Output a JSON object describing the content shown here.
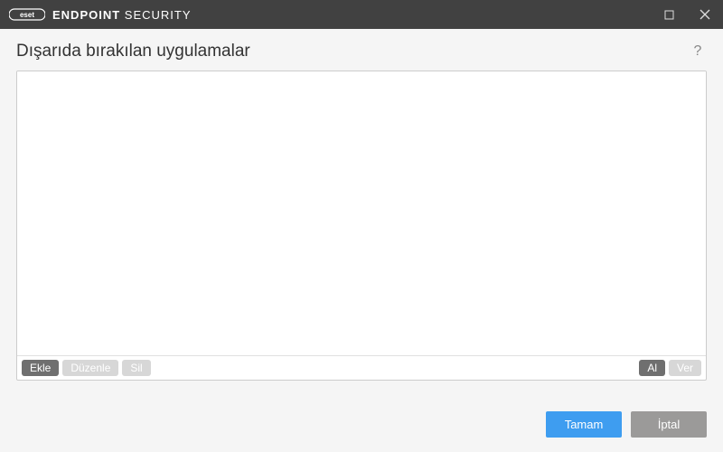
{
  "titlebar": {
    "brand_prefix": "ENDPOINT",
    "brand_suffix": " SECURITY"
  },
  "header": {
    "title": "Dışarıda bırakılan uygulamalar"
  },
  "toolbar": {
    "add": "Ekle",
    "edit": "Düzenle",
    "delete": "Sil",
    "import": "Al",
    "export": "Ver"
  },
  "footer": {
    "ok": "Tamam",
    "cancel": "İptal"
  }
}
